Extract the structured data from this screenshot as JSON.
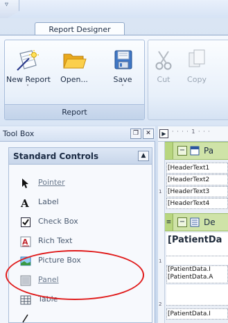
{
  "ribbon": {
    "tab_label": "Report Designer",
    "report_group_label": "Report",
    "buttons": {
      "new_report": "New Report",
      "open": "Open...",
      "save": "Save",
      "cut": "Cut",
      "copy": "Copy"
    }
  },
  "toolbox": {
    "title": "Tool Box",
    "pin_glyph": "❐",
    "close_glyph": "✕",
    "section": "Standard Controls",
    "collapse_glyph": "▲",
    "items": [
      {
        "label": "Pointer",
        "icon": "pointer-icon"
      },
      {
        "label": "Label",
        "icon": "label-icon"
      },
      {
        "label": "Check Box",
        "icon": "checkbox-icon"
      },
      {
        "label": "Rich Text",
        "icon": "rich-text-icon"
      },
      {
        "label": "Picture Box",
        "icon": "picture-box-icon"
      },
      {
        "label": "Panel",
        "icon": "panel-icon"
      },
      {
        "label": "Table",
        "icon": "table-icon"
      }
    ],
    "highlight_color": "#e01a1a"
  },
  "designer": {
    "expand_glyph": "▶",
    "ruler_text": "· · · · 1 · · ·",
    "page_header_band": "Pa",
    "detail_band": "De",
    "header_rows": [
      "[HeaderText1",
      "[HeaderText2",
      "[HeaderText3",
      "[HeaderText4"
    ],
    "detail_title": "[PatientDa",
    "detail_rows": [
      "[PatientData.I",
      "[PatientData.A",
      "[PatientData.I"
    ],
    "band_color": "#cfe3a8"
  }
}
